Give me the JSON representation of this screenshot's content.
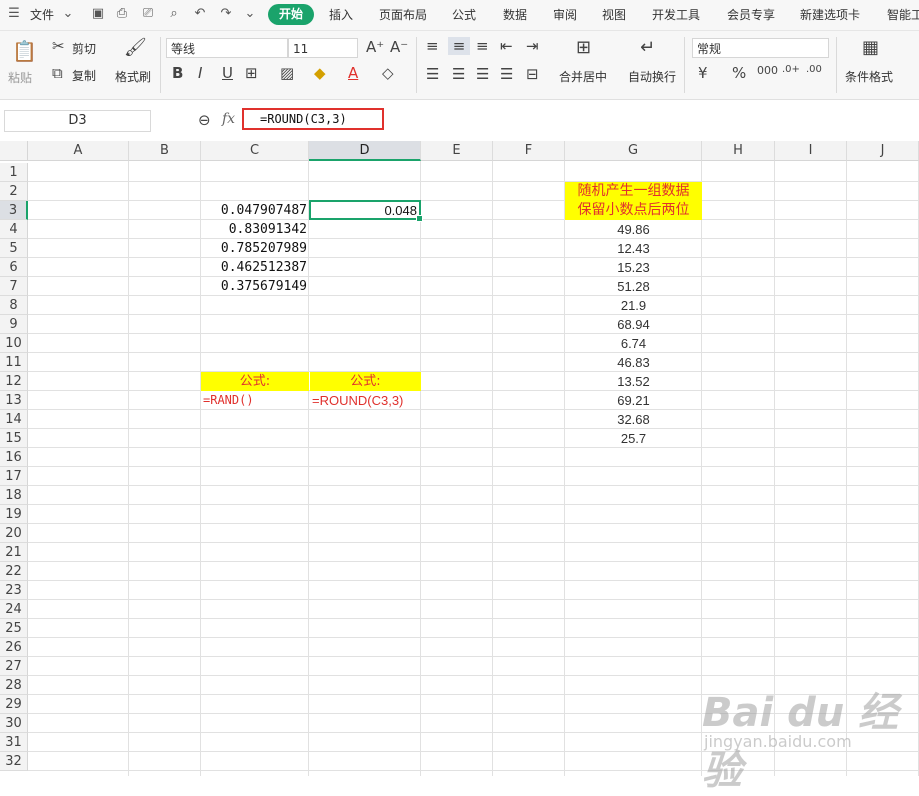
{
  "menu": {
    "file": "文件",
    "tabs": [
      "开始",
      "插入",
      "页面布局",
      "公式",
      "数据",
      "审阅",
      "视图",
      "开发工具",
      "会员专享",
      "新建选项卡",
      "智能工"
    ]
  },
  "ribbon": {
    "paste": "粘贴",
    "cut": "剪切",
    "copy": "复制",
    "format_painter": "格式刷",
    "font_name": "等线",
    "font_size": "11",
    "merge_center": "合并居中",
    "wrap_text": "自动换行",
    "number_format": "常规",
    "conditional_format": "条件格式"
  },
  "formula_bar": {
    "name_box": "D3",
    "fx": "fx",
    "formula": "=ROUND(C3,3)"
  },
  "columns": [
    "A",
    "B",
    "C",
    "D",
    "E",
    "F",
    "G",
    "H",
    "I",
    "J"
  ],
  "rows": [
    "1",
    "2",
    "3",
    "4",
    "5",
    "6",
    "7",
    "8",
    "9",
    "10",
    "11",
    "12",
    "13",
    "14",
    "15",
    "16",
    "17",
    "18",
    "19",
    "20",
    "21",
    "22",
    "23",
    "24",
    "25",
    "26",
    "27",
    "28",
    "29",
    "30",
    "31",
    "32"
  ],
  "cells": {
    "C": [
      "0.047907487",
      "0.83091342",
      "0.785207989",
      "0.462512387",
      "0.375679149"
    ],
    "D3": "0.048",
    "C12": "公式:",
    "D12": "公式:",
    "C13": "=RAND()",
    "D13": "=ROUND(C3,3)",
    "G2": "随机产生一组数据",
    "G3": "保留小数点后两位",
    "G": [
      "49.86",
      "12.43",
      "15.23",
      "51.28",
      "21.9",
      "68.94",
      "6.74",
      "46.83",
      "13.52",
      "69.21",
      "32.68",
      "25.7"
    ]
  },
  "watermark": {
    "logo": "Bai du 经验",
    "url": "jingyan.baidu.com"
  },
  "colors": {
    "accent": "#1aa36b",
    "highlight": "#ffff00",
    "red": "#e0312d"
  }
}
